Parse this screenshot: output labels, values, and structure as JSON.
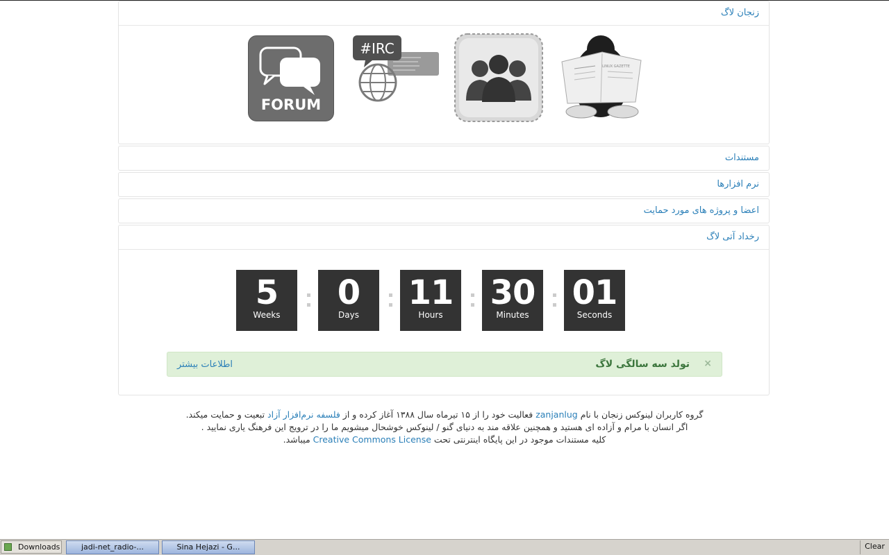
{
  "panels": {
    "zanjan_lug": "زنجان لاگ",
    "documents": "مستندات",
    "software": "نرم افزارها",
    "members": "اعضا و پروژه های مورد حمایت",
    "upcoming_event": "رخداد آتی لاگ"
  },
  "icons": {
    "forum_label": "FORUM",
    "irc_label": "#IRC",
    "newspaper_label": "LINUX GAZETTE"
  },
  "countdown": [
    {
      "value": "5",
      "label": "Weeks"
    },
    {
      "value": "0",
      "label": "Days"
    },
    {
      "value": "11",
      "label": "Hours"
    },
    {
      "value": "30",
      "label": "Minutes"
    },
    {
      "value": "01",
      "label": "Seconds"
    }
  ],
  "alert": {
    "title": "تولد سه سالگی لاگ",
    "close": "×",
    "more_link": "اطلاعات بیشتر"
  },
  "footer": {
    "l1_a": "گروه کاربران لینوکس زنجان با نام",
    "l1_link1": "zanjanlug",
    "l1_b": "فعالیت خود را از ۱۵ تیرماه سال ۱۳۸۸ آغاز کرده و از",
    "l1_link2": "فلسفه نرم‌افزار آزاد",
    "l1_c": "تبعیت و حمایت میکند.",
    "l2": "اگر انسان با مرام و آزاده ای هستید و همچنین علاقه مند به دنیای گنو / لینوکس خوشحال میشویم ما را در ترویج این فرهنگ یاری نمایید .",
    "l3_a": "کلیه مستندات موجود در این پایگاه اینترنتی تحت",
    "l3_link": "Creative Commons License",
    "l3_b": "میباشد."
  },
  "taskbar": {
    "downloads": "Downloads",
    "tasks": [
      "jadi-net_radio-...",
      "Sina Hejazi - G..."
    ],
    "clear": "Clear"
  },
  "colors": {
    "link": "#2a7fb8",
    "countdown_bg": "#333333",
    "alert_bg": "#dff0d8",
    "alert_text": "#3c763d"
  }
}
